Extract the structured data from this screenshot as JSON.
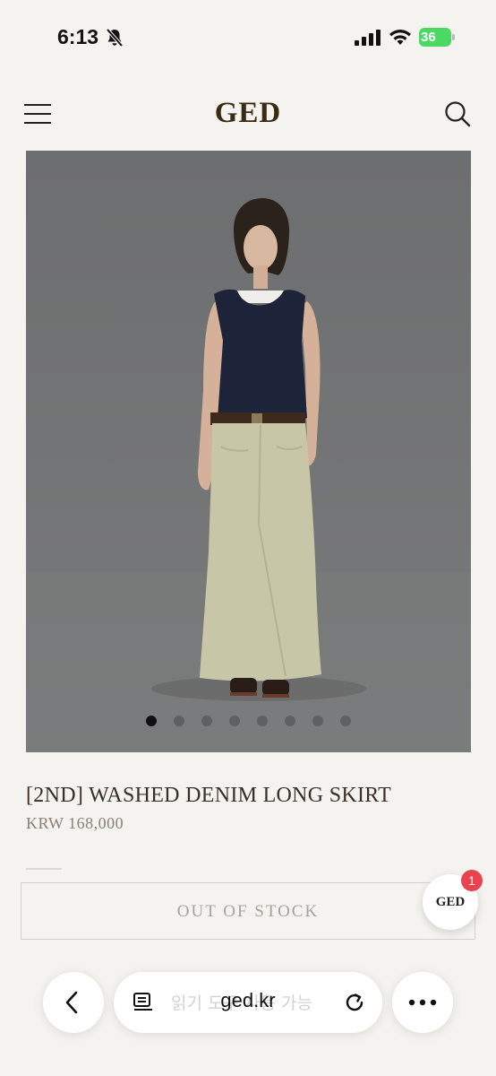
{
  "status_bar": {
    "time": "6:13",
    "battery": "36"
  },
  "header": {
    "logo": "GED",
    "menu_icon": "hamburger-menu-icon",
    "search_icon": "search-icon"
  },
  "product": {
    "title": "[2ND] WASHED DENIM LONG SKIRT",
    "price": "KRW 168,000",
    "carousel": {
      "total": 8,
      "active_index": 0
    },
    "button_label": "OUT OF STOCK"
  },
  "chat_widget": {
    "label": "GED",
    "badge_count": "1"
  },
  "browser": {
    "url": "ged.kr",
    "reader_hint": "읽기 도구 사용 가능"
  },
  "colors": {
    "background": "#f4f3ef",
    "logo": "#3a2b12",
    "badge": "#e8434f",
    "battery": "#4bd964"
  }
}
